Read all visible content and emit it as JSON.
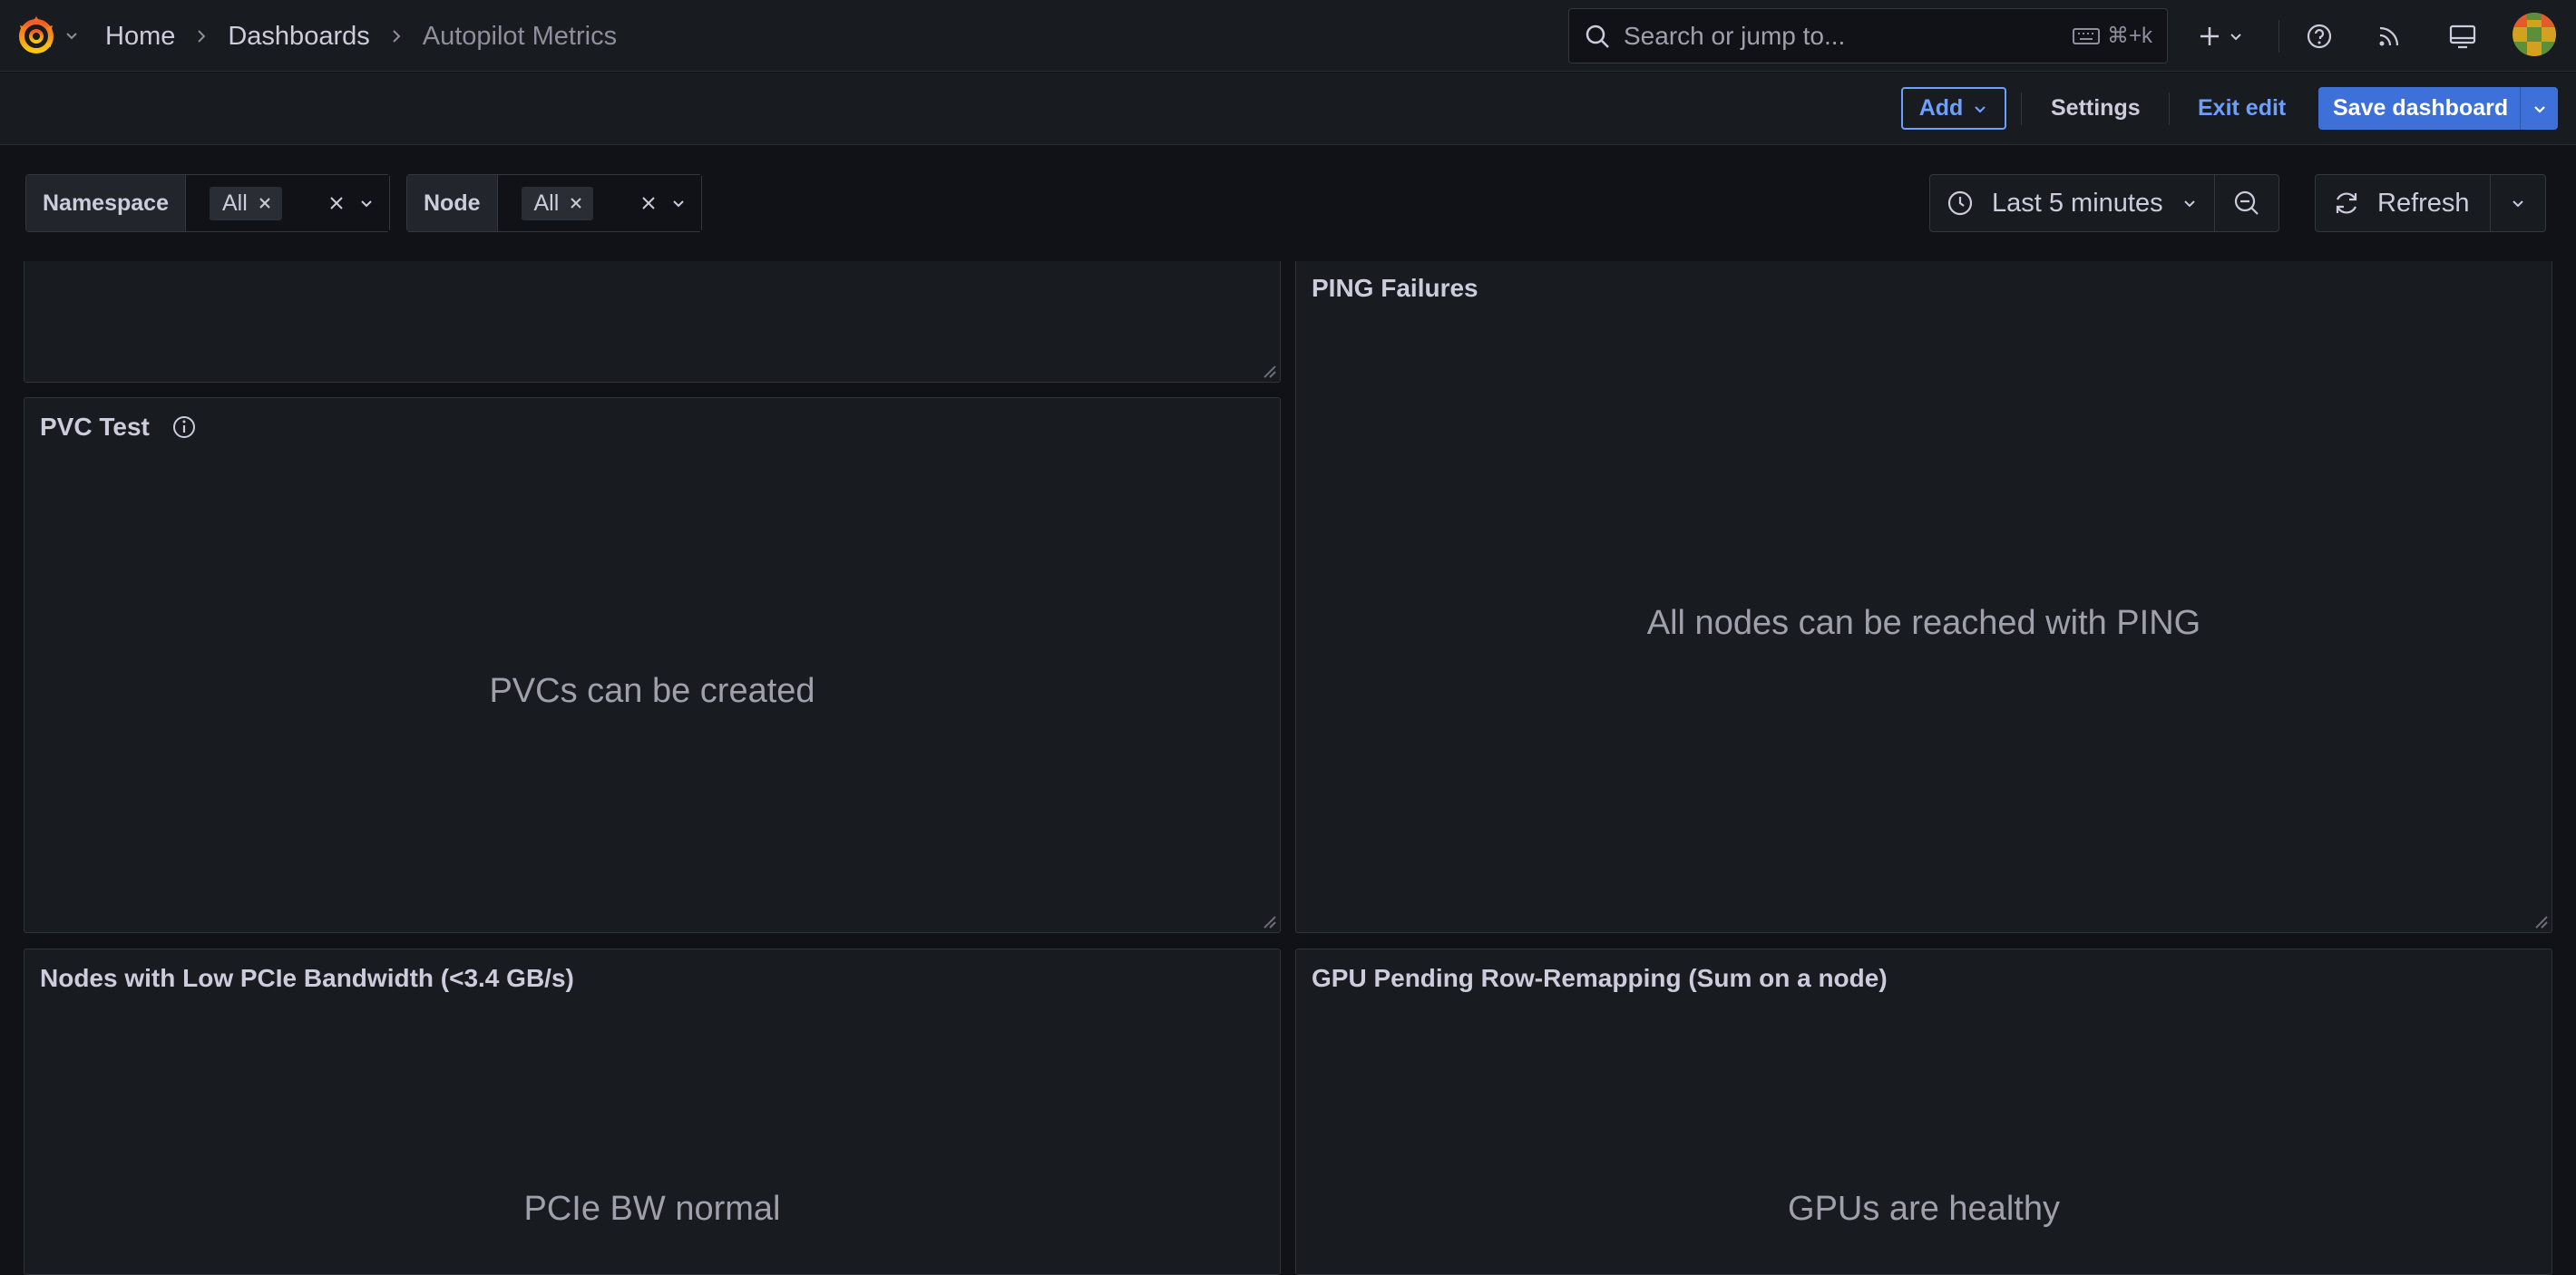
{
  "nav": {
    "breadcrumbs": [
      "Home",
      "Dashboards",
      "Autopilot Metrics"
    ],
    "search_placeholder": "Search or jump to...",
    "search_shortcut": "⌘+k"
  },
  "toolbar": {
    "add_label": "Add",
    "settings_label": "Settings",
    "exit_edit_label": "Exit edit",
    "save_label": "Save dashboard"
  },
  "variables": [
    {
      "label": "Namespace",
      "value": "All"
    },
    {
      "label": "Node",
      "value": "All"
    }
  ],
  "time": {
    "range_label": "Last 5 minutes",
    "refresh_label": "Refresh"
  },
  "panels": {
    "ping": {
      "title": "PING Failures",
      "message": "All nodes can be reached with PING"
    },
    "pvc": {
      "title": "PVC Test",
      "message": "PVCs can be created"
    },
    "pcie": {
      "title": "Nodes with Low PCIe Bandwidth (<3.4 GB/s)",
      "message": "PCIe BW normal"
    },
    "gpu": {
      "title": "GPU Pending Row-Remapping (Sum on a node)",
      "message": "GPUs are healthy"
    }
  },
  "colors": {
    "accent": "#3d71d9",
    "link": "#6e9fff",
    "background": "#111217",
    "panel": "#181b1f"
  },
  "icons": [
    "grafana-logo-icon",
    "chevron-down-icon",
    "chevron-right-icon",
    "search-icon",
    "keyboard-icon",
    "plus-icon",
    "help-icon",
    "rss-icon",
    "kiosk-icon",
    "close-icon",
    "clock-icon",
    "zoom-out-icon",
    "refresh-icon",
    "info-icon",
    "resize-handle-icon"
  ]
}
